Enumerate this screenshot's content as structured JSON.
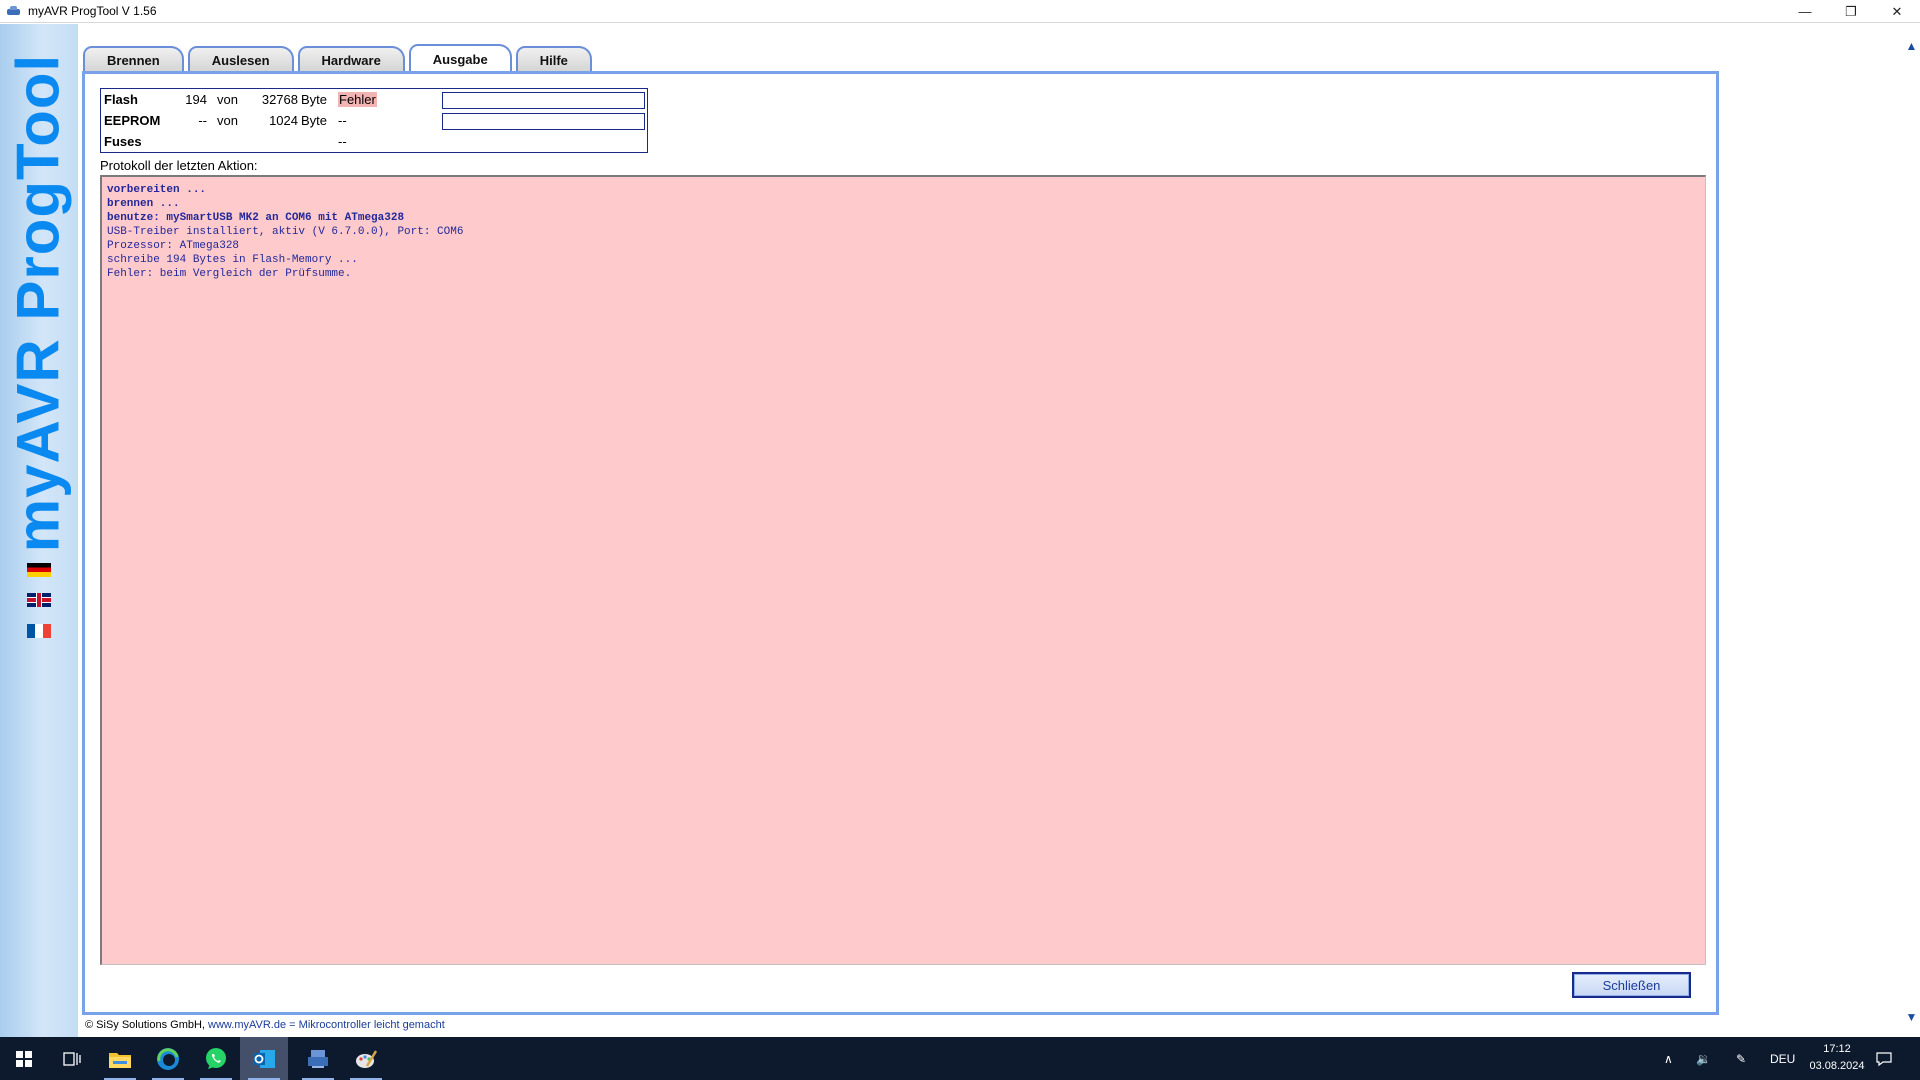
{
  "window": {
    "title": "myAVR ProgTool V 1.56",
    "minimize": "—",
    "restore": "❐",
    "close": "✕"
  },
  "sidebar": {
    "brand": "myAVR ProgTool",
    "languages": [
      "de",
      "en",
      "fr"
    ]
  },
  "tabs": [
    {
      "label": "Brennen",
      "active": false
    },
    {
      "label": "Auslesen",
      "active": false
    },
    {
      "label": "Hardware",
      "active": false
    },
    {
      "label": "Ausgabe",
      "active": true
    },
    {
      "label": "Hilfe",
      "active": false
    }
  ],
  "info": {
    "flash": {
      "label": "Flash",
      "used": "194",
      "von": "von",
      "total": "32768",
      "unit": "Byte",
      "status": "Fehler",
      "progress": 0
    },
    "eeprom": {
      "label": "EEPROM",
      "used": "--",
      "von": "von",
      "total": "1024",
      "unit": "Byte",
      "status": "--",
      "progress": 0
    },
    "fuses": {
      "label": "Fuses",
      "status": "--"
    }
  },
  "protocol": {
    "label": "Protokoll der letzten Aktion:",
    "lines": [
      "vorbereiten ...",
      "brennen ...",
      "benutze: mySmartUSB MK2 an COM6 mit ATmega328",
      "USB-Treiber installiert, aktiv (V 6.7.0.0), Port: COM6",
      "Prozessor: ATmega328",
      "schreibe 194 Bytes in Flash-Memory ...",
      "Fehler: beim Vergleich der Prüfsumme."
    ]
  },
  "close_button": "Schließen",
  "footer": {
    "copyright": "© SiSy Solutions GmbH,",
    "url": "www.myAVR.de",
    "separator": "=",
    "slogan": "Mikrocontroller leicht gemacht"
  },
  "taskbar": {
    "language": "DEU",
    "time": "17:12",
    "date": "03.08.2024"
  },
  "colors": {
    "log_background": "#fecacb",
    "log_text": "#22289a",
    "brand": "#0a8af0",
    "panel_border": "#7aa2ea"
  }
}
